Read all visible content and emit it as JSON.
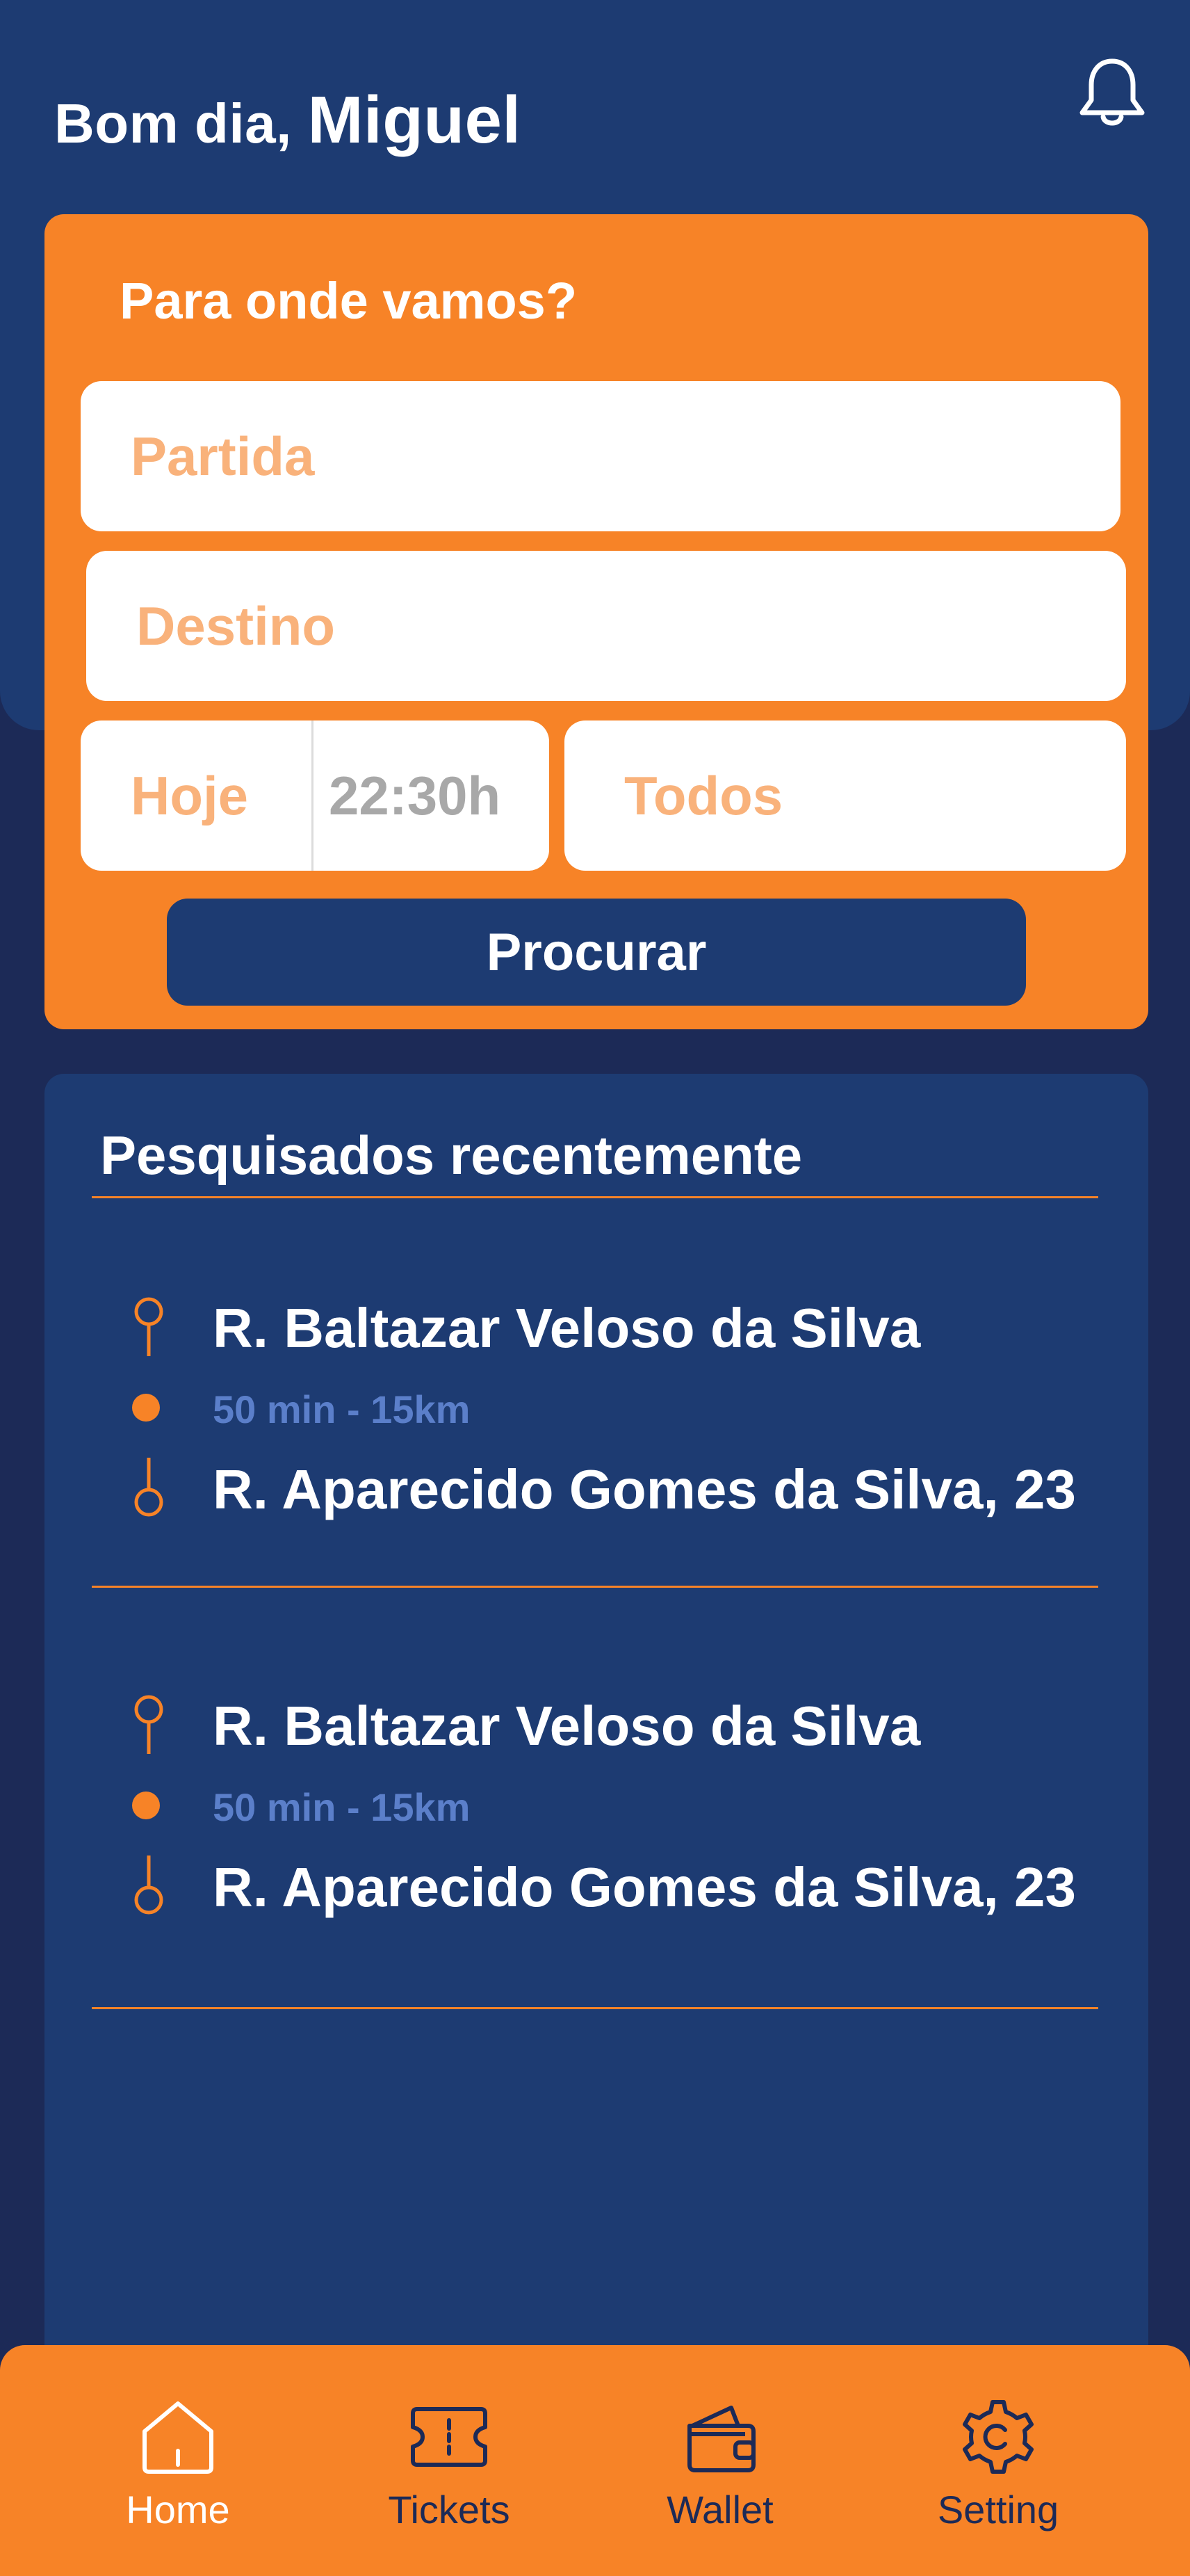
{
  "header": {
    "greeting": "Bom dia,",
    "user_name": "Miguel"
  },
  "search": {
    "title": "Para onde vamos?",
    "origin_placeholder": "Partida",
    "destination_placeholder": "Destino",
    "date_value": "Hoje",
    "time_value": "22:30h",
    "passengers_value": "Todos",
    "button_label": "Procurar"
  },
  "recent": {
    "title": "Pesquisados recentemente",
    "items": [
      {
        "from": "R. Baltazar Veloso da Silva",
        "meta": "50 min - 15km",
        "to": "R. Aparecido Gomes da Silva, 23"
      },
      {
        "from": "R. Baltazar Veloso da Silva",
        "meta": "50 min - 15km",
        "to": "R. Aparecido Gomes da Silva, 23"
      }
    ]
  },
  "nav": {
    "items": [
      {
        "label": "Home",
        "icon": "home-icon",
        "active": true
      },
      {
        "label": "Tickets",
        "icon": "ticket-icon",
        "active": false
      },
      {
        "label": "Wallet",
        "icon": "wallet-icon",
        "active": false
      },
      {
        "label": "Setting",
        "icon": "gear-icon",
        "active": false
      }
    ]
  },
  "colors": {
    "accent": "#f78327",
    "primary": "#1d3b72",
    "background": "#1c2a57",
    "placeholder": "#f9b27b",
    "meta": "#5b7fca"
  }
}
